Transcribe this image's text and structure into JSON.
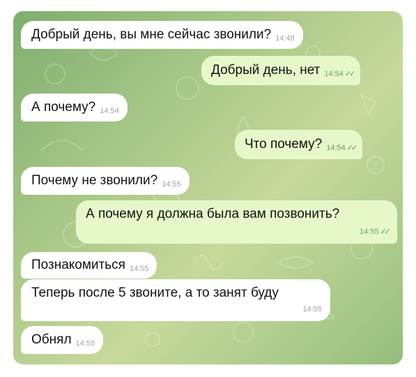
{
  "messages": [
    {
      "dir": "in",
      "text": "Добрый день, вы мне сейчас звонили?",
      "time": "14:48"
    },
    {
      "dir": "out",
      "text": "Добрый день, нет",
      "time": "14:54",
      "status": "read-icon"
    },
    {
      "dir": "in",
      "text": "А почему?",
      "time": "14:54"
    },
    {
      "dir": "out",
      "text": "Что почему?",
      "time": "14:54",
      "status": "read-icon"
    },
    {
      "dir": "in",
      "text": "Почему не звонили?",
      "time": "14:55"
    },
    {
      "dir": "out",
      "text": "А почему я должна была вам позвонить?",
      "time": "14:55",
      "status": "read-icon"
    },
    {
      "dir": "in",
      "text": "Познакомиться",
      "time": "14:55"
    },
    {
      "dir": "in",
      "text": "Теперь после 5 звоните, а то занят буду",
      "time": "14:55"
    },
    {
      "dir": "in",
      "text": "Обнял",
      "time": "14:55"
    }
  ],
  "colors": {
    "incoming": "#ffffff",
    "outgoing": "#e6f8c9",
    "wallpaper": "#a3c585",
    "checks": "#5b9c4c"
  }
}
